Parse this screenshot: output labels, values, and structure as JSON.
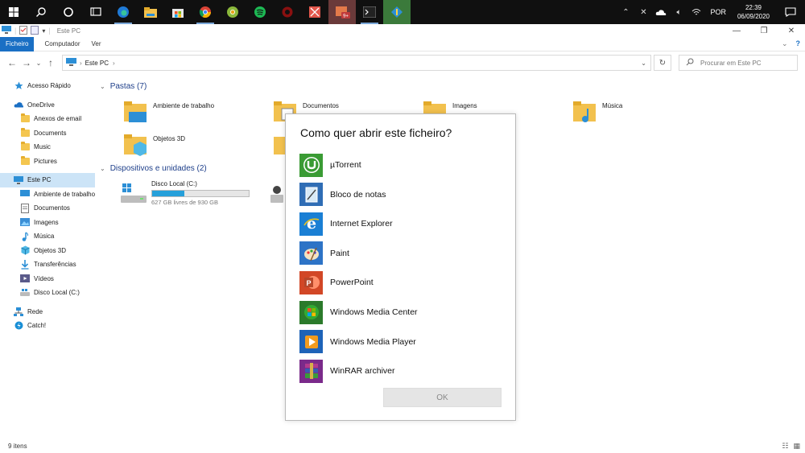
{
  "taskbar": {
    "icons": [
      "windows-start-icon",
      "search-icon",
      "cortana-icon",
      "task-view-icon",
      "edge-icon",
      "file-explorer-icon",
      "store-icon",
      "chrome-icon",
      "chrome-canary-icon",
      "spotify-icon",
      "ring-app-icon",
      "red-box-app-icon",
      "notification-app-icon",
      "terminal-icon",
      "diamond-app-icon"
    ],
    "badge": "9+",
    "tray": {
      "language": "POR",
      "time": "22:39",
      "date": "06/09/2020"
    }
  },
  "window": {
    "title": "Este PC",
    "ribbon_tabs": [
      "Ficheiro",
      "Computador",
      "Ver"
    ]
  },
  "address": {
    "path": "Este PC",
    "search_placeholder": "Procurar em Este PC"
  },
  "sidebar": {
    "items": [
      {
        "label": "Acesso Rápido",
        "icon": "star-icon",
        "indent": 0
      },
      {
        "label": "OneDrive",
        "icon": "cloud-icon",
        "indent": 0
      },
      {
        "label": "Anexos de email",
        "icon": "folder-icon",
        "indent": 1
      },
      {
        "label": "Documents",
        "icon": "folder-icon",
        "indent": 1
      },
      {
        "label": "Music",
        "icon": "folder-icon",
        "indent": 1
      },
      {
        "label": "Pictures",
        "icon": "folder-icon",
        "indent": 1
      },
      {
        "label": "Este PC",
        "icon": "computer-icon",
        "indent": 0,
        "selected": true
      },
      {
        "label": "Ambiente de trabalho",
        "icon": "desktop-icon",
        "indent": 1
      },
      {
        "label": "Documentos",
        "icon": "documents-icon",
        "indent": 1
      },
      {
        "label": "Imagens",
        "icon": "pictures-icon",
        "indent": 1
      },
      {
        "label": "Música",
        "icon": "music-icon",
        "indent": 1
      },
      {
        "label": "Objetos 3D",
        "icon": "cube-icon",
        "indent": 1
      },
      {
        "label": "Transferências",
        "icon": "download-icon",
        "indent": 1
      },
      {
        "label": "Vídeos",
        "icon": "video-icon",
        "indent": 1
      },
      {
        "label": "Disco Local (C:)",
        "icon": "drive-icon",
        "indent": 1
      },
      {
        "label": "Rede",
        "icon": "network-icon",
        "indent": 0
      },
      {
        "label": "Catch!",
        "icon": "catch-icon",
        "indent": 0
      }
    ]
  },
  "content": {
    "folders_header": "Pastas (7)",
    "folders": [
      "Ambiente de trabalho",
      "Documentos",
      "Imagens",
      "Música",
      "Objetos 3D"
    ],
    "devices_header": "Dispositivos e unidades (2)",
    "drive": {
      "name": "Disco Local (C:)",
      "free": "627 GB livres de 930 GB",
      "used_fraction": 0.33
    }
  },
  "dialog": {
    "title": "Como quer abrir este ficheiro?",
    "apps": [
      {
        "label": "µTorrent",
        "icon": "utorrent-icon",
        "color": "#3a9b34"
      },
      {
        "label": "Bloco de notas",
        "icon": "notepad-icon",
        "color": "#2f6db5"
      },
      {
        "label": "Internet Explorer",
        "icon": "internet-explorer-icon",
        "color": "#1a7fd4"
      },
      {
        "label": "Paint",
        "icon": "paint-icon",
        "color": "#2d73c6"
      },
      {
        "label": "PowerPoint",
        "icon": "powerpoint-icon",
        "color": "#d24726"
      },
      {
        "label": "Windows Media Center",
        "icon": "media-center-icon",
        "color": "#2b7a2b"
      },
      {
        "label": "Windows Media Player",
        "icon": "media-player-icon",
        "color": "#1e63b8"
      },
      {
        "label": "WinRAR archiver",
        "icon": "winrar-icon",
        "color": "#7a2a8a"
      }
    ],
    "ok_label": "OK"
  },
  "status": {
    "count": "9 itens"
  }
}
